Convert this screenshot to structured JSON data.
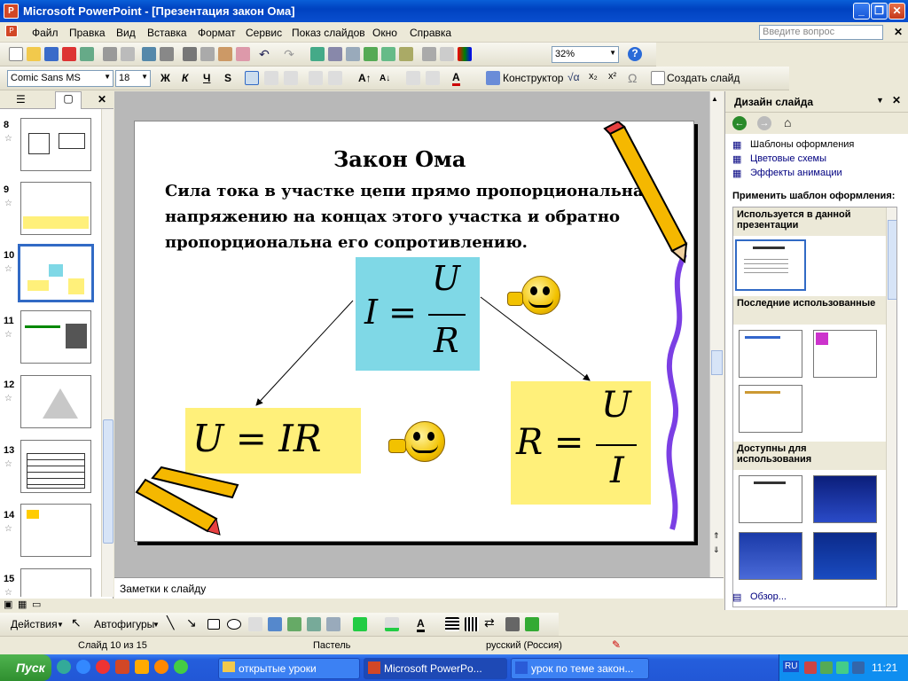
{
  "window": {
    "title": "Microsoft PowerPoint - [Презентация закон Ома]"
  },
  "menu": {
    "items": [
      "Файл",
      "Правка",
      "Вид",
      "Вставка",
      "Формат",
      "Сервис",
      "Показ слайдов",
      "Окно",
      "Справка"
    ],
    "question_placeholder": "Введите вопрос"
  },
  "toolbar": {
    "zoom": "32%",
    "font_name": "Comic Sans MS",
    "font_size": "18",
    "bold": "Ж",
    "italic": "К",
    "underline": "Ч",
    "shadow": "S",
    "designer": "Конструктор",
    "new_slide": "Создать слайд"
  },
  "slides_pane": {
    "numbers": [
      "8",
      "9",
      "10",
      "11",
      "12",
      "13",
      "14",
      "15"
    ],
    "selected": "10"
  },
  "slide": {
    "title": "Закон Ома",
    "body": "Сила тока в участке цепи прямо пропорциональна напряжению на концах этого участка и обратно пропорциональна его сопротивлению.",
    "formula_main_lhs": "I =",
    "formula_main_num": "U",
    "formula_main_den": "R",
    "formula_left": "U = IR",
    "formula_right_lhs": "R =",
    "formula_right_num": "U",
    "formula_right_den": "I"
  },
  "notes": {
    "placeholder": "Заметки к слайду"
  },
  "task_pane": {
    "title": "Дизайн слайда",
    "links": [
      "Шаблоны оформления",
      "Цветовые схемы",
      "Эффекты анимации"
    ],
    "apply_label": "Применить шаблон оформления:",
    "section_used": "Используется в данной презентации",
    "section_recent": "Последние использованные",
    "section_available": "Доступны для использования",
    "browse": "Обзор..."
  },
  "draw_toolbar": {
    "actions": "Действия",
    "autoshapes": "Автофигуры"
  },
  "status": {
    "slide_info": "Слайд 10 из 15",
    "design": "Пастель",
    "language": "русский (Россия)"
  },
  "taskbar": {
    "start": "Пуск",
    "buttons": [
      "открытые уроки",
      "Microsoft PowerPo...",
      "урок по теме закон..."
    ],
    "lang": "RU",
    "clock": "11:21"
  },
  "colors": {
    "formula_blue": "#7fd8e6",
    "formula_yellow": "#fff07a"
  }
}
